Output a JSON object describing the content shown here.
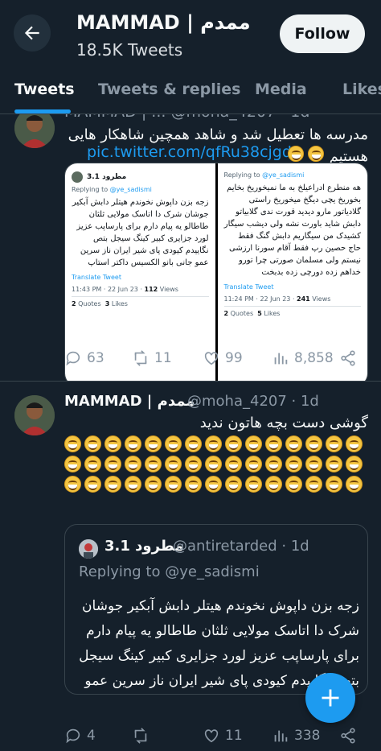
{
  "header": {
    "title": "MAMMAD | ممدم",
    "subtitle": "18.5K Tweets",
    "follow_label": "Follow"
  },
  "tabs": [
    {
      "label": "Tweets"
    },
    {
      "label": "Tweets & replies"
    },
    {
      "label": "Media"
    },
    {
      "label": "Likes"
    }
  ],
  "tweet1": {
    "header_cut": "MAMMAD | ... @moha_4207 · 1d",
    "text": "مدرسه ها تعطیل شد و شاهد همچین شاهکار هایی هستیم",
    "link": "pic.twitter.com/qfRu38cjgd",
    "shot_left": {
      "name": "3.1 مطرود",
      "handle": "@antiretarded",
      "replying": "Replying to",
      "replying_handle": "@ye_sadismi",
      "body": "زجه بزن داپوش نخوندم هیتلر دابش آبکیر جوشان شرک دا اتاسک مولایی ثلثان طاطالو یه پیام دارم برای پارساپب عزیز لورد جزایری کبیر کینگ سیجل بتص نگاییدم کیودی پای شیر ایران ناز سرین عمو جانی بانو الکسیس داکتر استاپ",
      "translate": "Translate Tweet",
      "time": "11:43 PM · 22 Jun 23 ·",
      "views": "112",
      "views_label": "Views",
      "quotes": "2",
      "quotes_label": "Quotes",
      "likes": "3",
      "likes_label": "Likes"
    },
    "shot_right": {
      "replying": "Replying to",
      "replying_handle": "@ye_sadismi",
      "body": "هه منطرع ادراعیلخ به ما نمیخوریخ بخایم بخوریخ یچی دیگخ میخوریخ راستی گلادیاتور مارو دیدید قورت ندی گلابیاتو دابش شاید باورت نشه ولی دیشب سیگار کشیدک من سیگاریم دابش گنگ فقط حاج حصین رپ فقط آقام سورنا ارزشی نیستم ولی مسلمان صورتی چرا تورو خداهم زده دورچی زده بدبخت",
      "translate": "Translate Tweet",
      "time": "11:24 PM · 22 Jun 23 ·",
      "views": "241",
      "views_label": "Views",
      "quotes": "2",
      "quotes_label": "Quotes",
      "likes": "5",
      "likes_label": "Likes"
    },
    "stats": {
      "replies": "63",
      "retweets": "11",
      "likes": "99",
      "views": "8,858"
    }
  },
  "tweet2": {
    "name": "MAMMAD | ممدم",
    "handle": "@moha_4207 · 1d",
    "text": "گوشی دست بچه هاتون ندید",
    "emoji_count": 45,
    "quote": {
      "name": "3.1 مطرود",
      "handle": "@antiretarded · 1d",
      "replying": "Replying to",
      "replying_handle": "@ye_sadismi",
      "body": "زجه بزن داپوش نخوندم هیتلر دابش آبکیر جوشان شرک دا اتاسک مولایی ثلثان طاطالو یه پیام دارم برای پارساپب عزیز لورد جزایری کبیر کینگ سیجل بتص نگاییدم کیودی پای شیر ایران ناز سرین عمو جانی..."
    },
    "stats": {
      "replies": "4",
      "likes": "11",
      "views": "338"
    }
  },
  "colors": {
    "accent": "#1d9bf0",
    "background": "#15202b",
    "muted": "#8b98a5"
  }
}
